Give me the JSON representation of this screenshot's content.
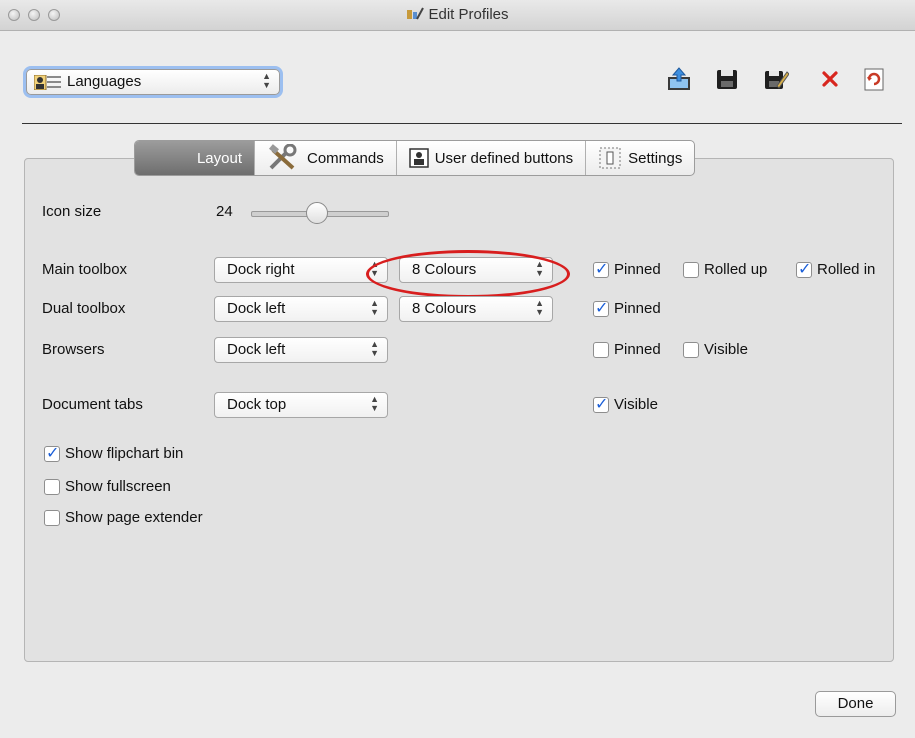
{
  "window": {
    "title": "Edit Profiles"
  },
  "profile": {
    "selected": "Languages"
  },
  "toolbar": {
    "icons": [
      "export-icon",
      "save-icon",
      "save-as-icon",
      "delete-icon",
      "reload-icon"
    ],
    "colors": {
      "delete": "#d8261e",
      "reload": "#c83a26"
    }
  },
  "tabs": [
    {
      "label": "Layout",
      "active": true
    },
    {
      "label": "Commands"
    },
    {
      "label": "User defined buttons"
    },
    {
      "label": "Settings"
    }
  ],
  "layout": {
    "icon_size": {
      "label": "Icon size",
      "value": "24"
    },
    "main_toolbox": {
      "label": "Main toolbox",
      "dock": "Dock right",
      "colours": "8 Colours",
      "pinned": "Pinned",
      "rolled_up": "Rolled up",
      "rolled_in": "Rolled in"
    },
    "dual_toolbox": {
      "label": "Dual toolbox",
      "dock": "Dock left",
      "colours": "8 Colours",
      "pinned": "Pinned"
    },
    "browsers": {
      "label": "Browsers",
      "dock": "Dock left",
      "pinned": "Pinned",
      "visible": "Visible"
    },
    "document_tabs": {
      "label": "Document tabs",
      "dock": "Dock top",
      "visible": "Visible"
    },
    "options": {
      "flipchart_bin": "Show flipchart bin",
      "fullscreen": "Show fullscreen",
      "page_extender": "Show page extender"
    }
  },
  "footer": {
    "done": "Done"
  },
  "annotation_color": "#d81e1e"
}
